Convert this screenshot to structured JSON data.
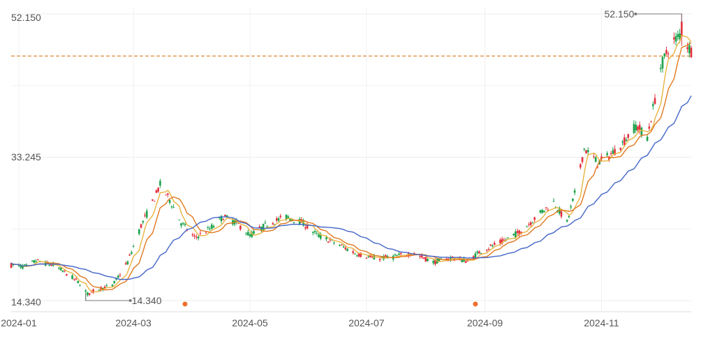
{
  "chart_data": {
    "type": "candlestick",
    "y_ticks": [
      "52.150",
      "33.245",
      "14.340"
    ],
    "y_tick_values": [
      52.15,
      33.245,
      14.34
    ],
    "ylim": [
      14.34,
      52.15
    ],
    "x_ticks": [
      "2024-01",
      "2024-03",
      "2024-05",
      "2024-07",
      "2024-09",
      "2024-11"
    ],
    "x_tick_dates": [
      "2024-01-01",
      "2024-03-01",
      "2024-05-01",
      "2024-07-01",
      "2024-09-01",
      "2024-11-01"
    ],
    "date_range": [
      "2023-12-28",
      "2024-12-18"
    ],
    "max_label": "52.150",
    "min_label": "14.340",
    "max_point": {
      "date": "2024-12-13",
      "value": 52.15
    },
    "min_point": {
      "date": "2024-02-05",
      "value": 14.34
    },
    "reference_line": {
      "value": 46.6,
      "style": "dashed"
    },
    "markers": [
      {
        "date": "2024-03-28"
      },
      {
        "date": "2024-08-27"
      }
    ],
    "anchors": [
      [
        "2023-12-28",
        19.0
      ],
      [
        "2024-01-05",
        18.8
      ],
      [
        "2024-01-10",
        19.6
      ],
      [
        "2024-01-20",
        18.9
      ],
      [
        "2024-01-26",
        17.9
      ],
      [
        "2024-02-02",
        16.6
      ],
      [
        "2024-02-06",
        15.2
      ],
      [
        "2024-02-12",
        15.9
      ],
      [
        "2024-02-19",
        16.3
      ],
      [
        "2024-02-27",
        19.4
      ],
      [
        "2024-03-05",
        24.2
      ],
      [
        "2024-03-11",
        27.3
      ],
      [
        "2024-03-15",
        29.6
      ],
      [
        "2024-03-20",
        27.6
      ],
      [
        "2024-03-26",
        24.6
      ],
      [
        "2024-04-02",
        22.6
      ],
      [
        "2024-04-10",
        23.8
      ],
      [
        "2024-04-17",
        25.4
      ],
      [
        "2024-04-24",
        24.6
      ],
      [
        "2024-05-01",
        22.9
      ],
      [
        "2024-05-10",
        24.4
      ],
      [
        "2024-05-20",
        25.4
      ],
      [
        "2024-05-28",
        24.7
      ],
      [
        "2024-06-05",
        23.0
      ],
      [
        "2024-06-15",
        21.9
      ],
      [
        "2024-06-25",
        20.6
      ],
      [
        "2024-07-05",
        19.9
      ],
      [
        "2024-07-15",
        20.1
      ],
      [
        "2024-07-25",
        20.6
      ],
      [
        "2024-08-05",
        19.4
      ],
      [
        "2024-08-15",
        20.0
      ],
      [
        "2024-08-23",
        19.5
      ],
      [
        "2024-08-30",
        20.9
      ],
      [
        "2024-09-10",
        22.1
      ],
      [
        "2024-09-20",
        23.5
      ],
      [
        "2024-09-30",
        25.9
      ],
      [
        "2024-10-07",
        27.3
      ],
      [
        "2024-10-14",
        24.6
      ],
      [
        "2024-10-18",
        28.4
      ],
      [
        "2024-10-23",
        34.4
      ],
      [
        "2024-10-30",
        32.5
      ],
      [
        "2024-11-05",
        33.4
      ],
      [
        "2024-11-12",
        35.1
      ],
      [
        "2024-11-19",
        37.4
      ],
      [
        "2024-11-25",
        35.9
      ],
      [
        "2024-11-29",
        40.9
      ],
      [
        "2024-12-02",
        45.1
      ],
      [
        "2024-12-06",
        47.6
      ],
      [
        "2024-12-12",
        49.4
      ],
      [
        "2024-12-18",
        47.3
      ]
    ],
    "series": [
      {
        "type": "candles",
        "up_color": "#e5303e",
        "down_color": "#1aa34a"
      },
      {
        "type": "ma",
        "period": 5,
        "color": "#e9b33f"
      },
      {
        "type": "ma",
        "period": 10,
        "color": "#e0781f"
      },
      {
        "type": "ma",
        "period": 30,
        "color": "#4466c8"
      }
    ],
    "grid": true
  }
}
